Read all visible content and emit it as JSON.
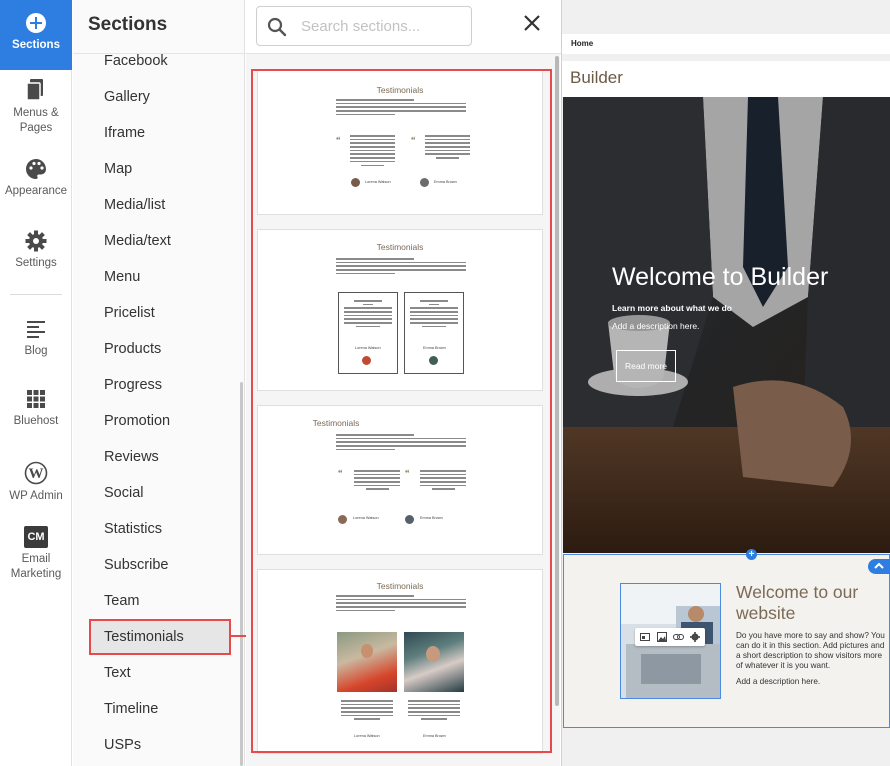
{
  "nav": {
    "items": [
      {
        "label": "Sections",
        "icon": "plus-circle-icon"
      },
      {
        "label": "Menus & Pages",
        "icon": "pages-icon"
      },
      {
        "label": "Appearance",
        "icon": "palette-icon"
      },
      {
        "label": "Settings",
        "icon": "gear-icon"
      },
      {
        "label": "Blog",
        "icon": "blog-icon"
      },
      {
        "label": "Bluehost",
        "icon": "grid-icon"
      },
      {
        "label": "WP Admin",
        "icon": "wordpress-icon"
      },
      {
        "label": "Email Marketing",
        "icon": "cm-icon",
        "badge": "CM"
      }
    ],
    "accent": "#2d7ee0"
  },
  "sections_panel": {
    "title": "Sections",
    "search_placeholder": "Search sections...",
    "items": [
      "Facebook",
      "Gallery",
      "Iframe",
      "Map",
      "Media/list",
      "Media/text",
      "Menu",
      "Pricelist",
      "Products",
      "Progress",
      "Promotion",
      "Reviews",
      "Social",
      "Statistics",
      "Subscribe",
      "Team",
      "Testimonials",
      "Text",
      "Timeline",
      "USPs"
    ],
    "selected": "Testimonials"
  },
  "previews": [
    {
      "title": "Testimonials",
      "names": [
        "Lorena Watson",
        "Emma Brown"
      ]
    },
    {
      "title": "Testimonials",
      "names": [
        "Lorena Watson",
        "Emma Brown"
      ]
    },
    {
      "title": "Testimonials",
      "names": [
        "Lorena Watson",
        "Emma Brown"
      ]
    },
    {
      "title": "Testimonials",
      "names": [
        "Lorena Watson",
        "Emma Brown"
      ]
    }
  ],
  "editor": {
    "nav_home": "Home",
    "brand": "Builder",
    "hero": {
      "heading": "Welcome to Builder",
      "line1": "Learn more about what we do",
      "line2": "Add a description here.",
      "button": "Read more"
    },
    "section2": {
      "heading": "Welcome to our website",
      "body": "Do you have more to say and show? You can do it in this section. Add pictures and a short description to show visitors more of whatever it is you want.",
      "extra": "Add a description here."
    }
  },
  "colors": {
    "highlight_red": "#e64a4a",
    "brand_brown": "#7b6a55",
    "selection_blue": "#4a8ae0"
  }
}
